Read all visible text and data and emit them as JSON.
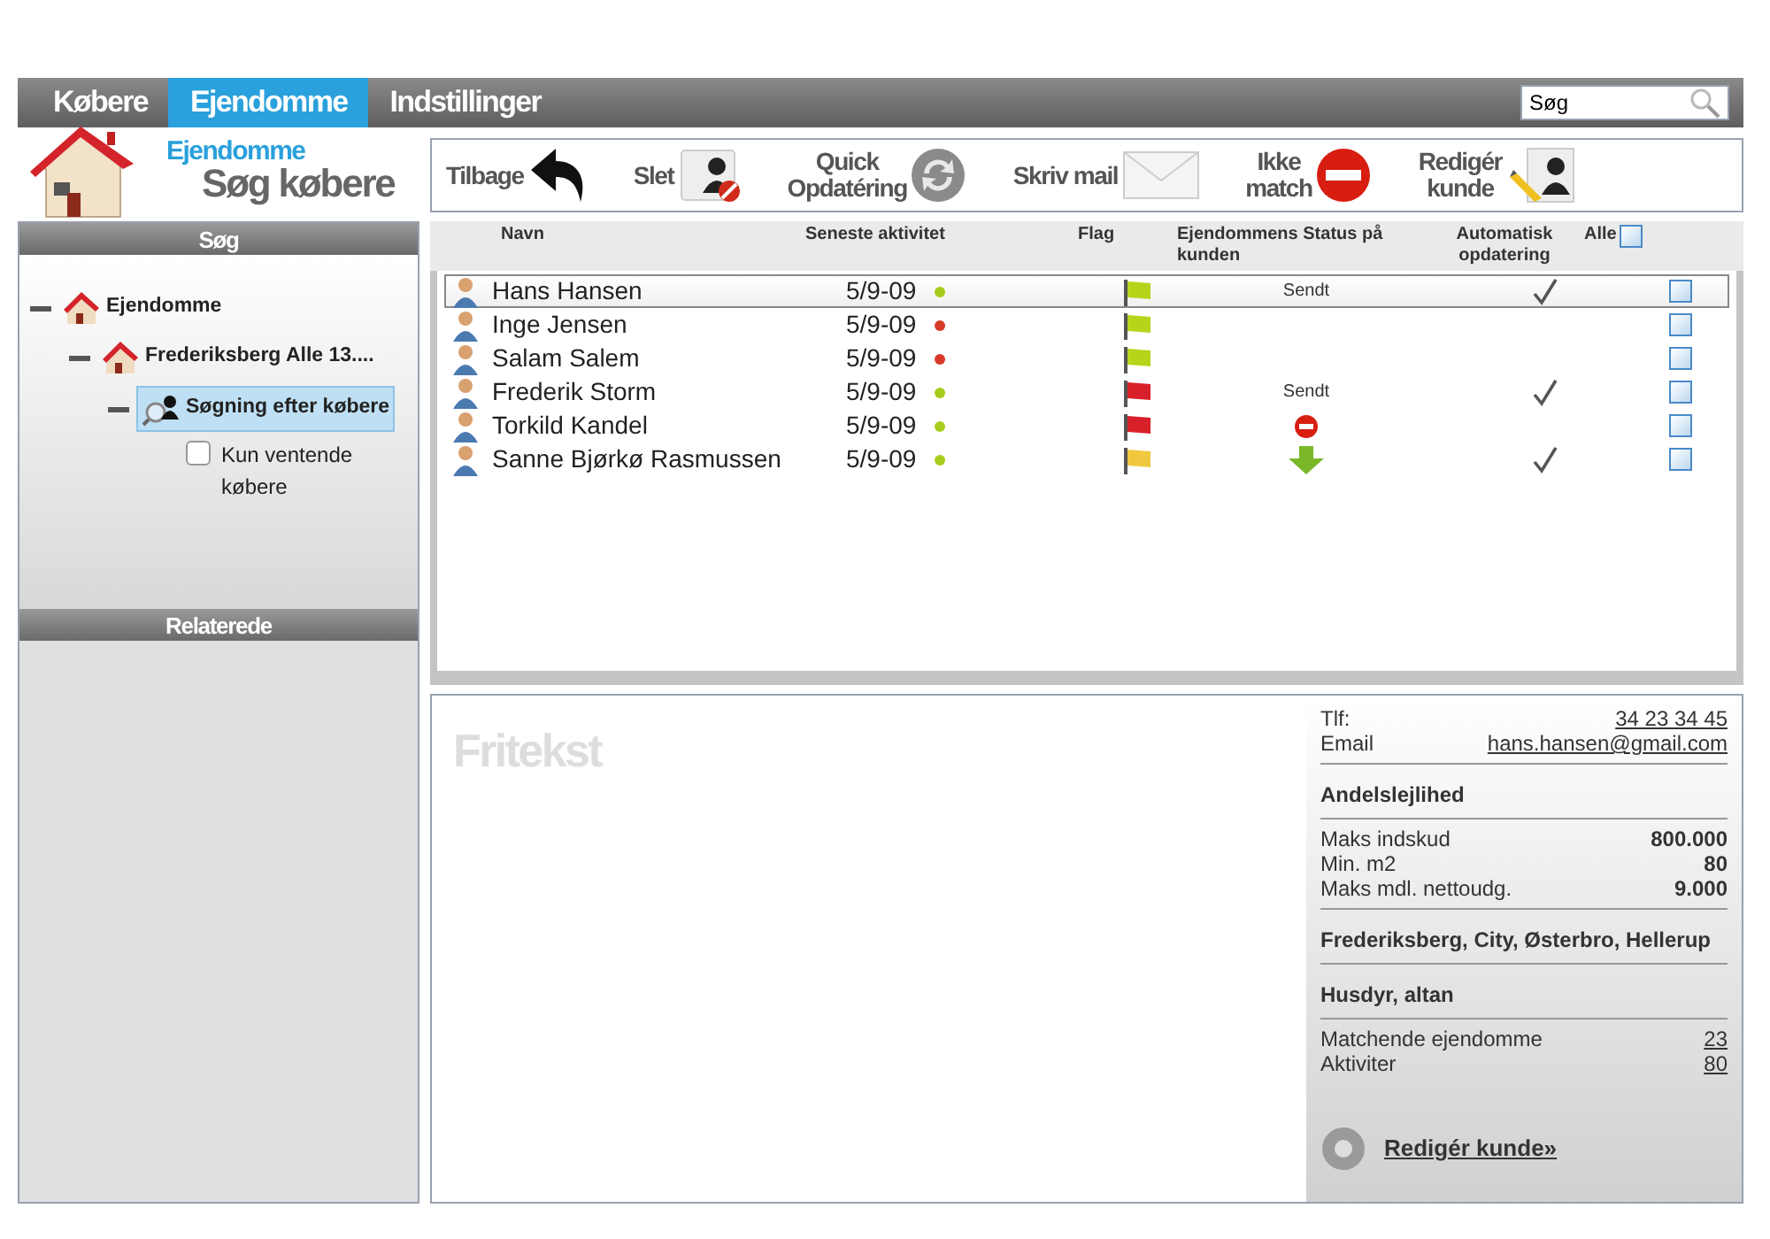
{
  "nav": {
    "tabs": [
      {
        "label": "Købere",
        "selected": false
      },
      {
        "label": "Ejendomme",
        "selected": true
      },
      {
        "label": "Indstillinger",
        "selected": false
      }
    ],
    "search": {
      "value": "Søg"
    }
  },
  "header": {
    "section": "Ejendomme",
    "title": "Søg købere"
  },
  "toolbar": [
    {
      "label": "Tilbage",
      "kind": "back"
    },
    {
      "label": "Slet",
      "kind": "delete"
    },
    {
      "label": "Quick\nOpdatéring",
      "kind": "refresh"
    },
    {
      "label": "Skriv mail",
      "kind": "mail"
    },
    {
      "label": "Ikke\nmatch",
      "kind": "nomatch"
    },
    {
      "label": "Redigér\nkunde",
      "kind": "edit"
    }
  ],
  "sidebar": {
    "search_title": "Søg",
    "tree": [
      {
        "label": "Ejendomme",
        "kind": "house",
        "expanded": true,
        "selected": false,
        "children": [
          {
            "label": "Frederiksberg Alle 13....",
            "kind": "house",
            "expanded": true,
            "selected": false,
            "children": [
              {
                "label": "Søgning efter købere",
                "kind": "search",
                "expanded": true,
                "selected": true
              }
            ]
          }
        ]
      }
    ],
    "filter": {
      "label": "Kun ventende købere",
      "checked": false
    },
    "related_title": "Relaterede"
  },
  "table": {
    "columns": [
      "Navn",
      "Seneste aktivitet",
      "Flag",
      "Ejendommens Status på kunden",
      "Automatisk opdatering",
      "Alle"
    ],
    "all_checked": false,
    "rows": [
      {
        "name": "Hans Hansen",
        "date": "5/9-09",
        "activity": {
          "color": "#a8cc1c"
        },
        "flag": {
          "color": "#b8d41a"
        },
        "status": {
          "kind": "text",
          "text": "Sendt"
        },
        "auto_update": true,
        "checked": false,
        "selected": true
      },
      {
        "name": "Inge Jensen",
        "date": "5/9-09",
        "activity": {
          "color": "#d83a2a"
        },
        "flag": {
          "color": "#b8d41a"
        },
        "status": {
          "kind": "none"
        },
        "auto_update": false,
        "checked": false,
        "selected": false
      },
      {
        "name": "Salam Salem",
        "date": "5/9-09",
        "activity": {
          "color": "#d83a2a"
        },
        "flag": {
          "color": "#b8d41a"
        },
        "status": {
          "kind": "none"
        },
        "auto_update": false,
        "checked": false,
        "selected": false
      },
      {
        "name": "Frederik Storm",
        "date": "5/9-09",
        "activity": {
          "color": "#a8cc1c"
        },
        "flag": {
          "color": "#d8202a"
        },
        "status": {
          "kind": "text",
          "text": "Sendt"
        },
        "auto_update": true,
        "checked": false,
        "selected": false
      },
      {
        "name": "Torkild Kandel",
        "date": "5/9-09",
        "activity": {
          "color": "#a8cc1c"
        },
        "flag": {
          "color": "#d8202a"
        },
        "status": {
          "kind": "blocked"
        },
        "auto_update": false,
        "checked": false,
        "selected": false
      },
      {
        "name": "Sanne Bjørkø Rasmussen",
        "date": "5/9-09",
        "activity": {
          "color": "#a8cc1c"
        },
        "flag": {
          "color": "#f0c840"
        },
        "status": {
          "kind": "arrow"
        },
        "auto_update": true,
        "checked": false,
        "selected": false
      }
    ]
  },
  "notes": {
    "title": "Fritekst"
  },
  "details": {
    "contact": [
      {
        "label": "Tlf:",
        "value": "34 23 34 45"
      },
      {
        "label": "Email",
        "value": "hans.hansen@gmail.com"
      }
    ],
    "housing": "Andelslejlihed",
    "figures": [
      {
        "label": "Maks indskud",
        "value": "800.000"
      },
      {
        "label": "Min. m2",
        "value": "80"
      },
      {
        "label": "Maks mdl. nettoudg.",
        "value": "9.000"
      }
    ],
    "areas": "Frederiksberg, City, Østerbro, Hellerup",
    "extras": "Husdyr, altan",
    "counts": [
      {
        "label": "Matchende ejendomme",
        "value": "23"
      },
      {
        "label": "Aktiviter",
        "value": "80"
      }
    ],
    "edit_link": "Redigér kunde»"
  }
}
